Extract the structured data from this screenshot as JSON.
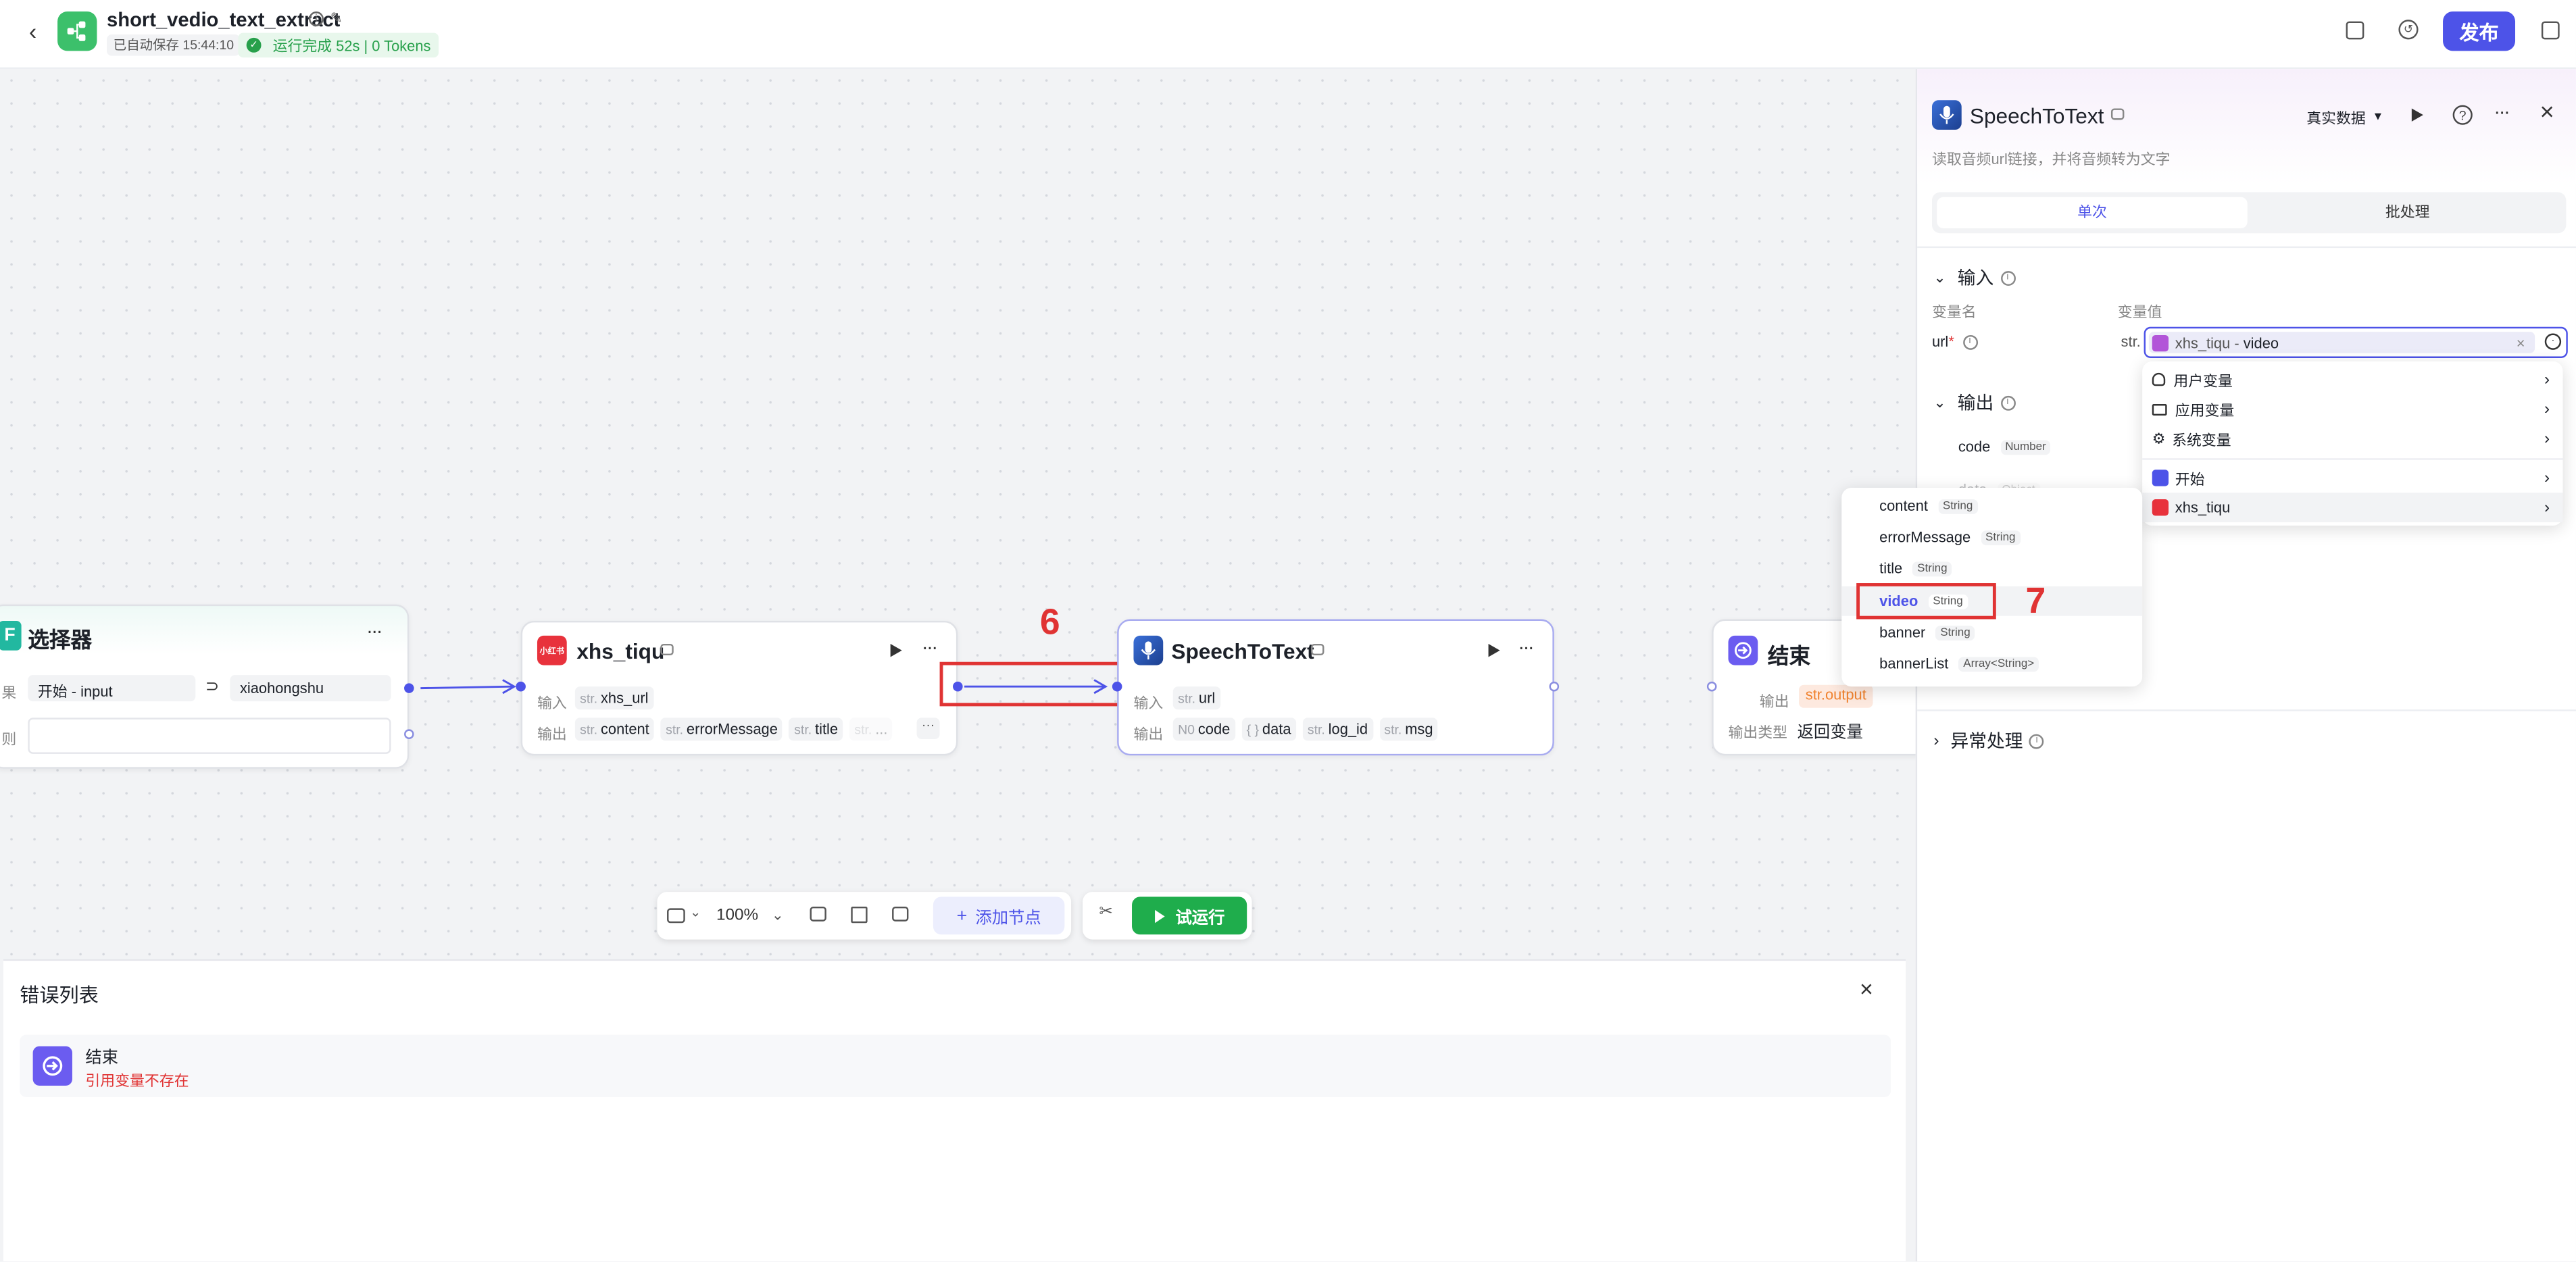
{
  "header": {
    "app_title": "short_vedio_text_extract",
    "autosave": "已自动保存 15:44:10",
    "run_status": "运行完成 52s | 0 Tokens",
    "publish_label": "发布",
    "accent_color": "#4d53e8"
  },
  "nodes": {
    "selector": {
      "title": "选择器",
      "row1_label": "果",
      "cond_left": "开始 - input",
      "cond_op": "⊃",
      "cond_right": "xiaohongshu",
      "row2_label": "则",
      "icon": "F"
    },
    "xhs": {
      "title": "xhs_tiqu",
      "icon_text": "小红书",
      "input_label": "输入",
      "input_tags": [
        {
          "type": "str.",
          "name": "xhs_url"
        }
      ],
      "output_label": "输出",
      "output_tags": [
        {
          "type": "str.",
          "name": "content"
        },
        {
          "type": "str.",
          "name": "errorMessage"
        },
        {
          "type": "str.",
          "name": "title"
        },
        {
          "type": "str.",
          "name": "..."
        }
      ],
      "more": "···"
    },
    "speech": {
      "title": "SpeechToText",
      "input_label": "输入",
      "input_tags": [
        {
          "type": "str.",
          "name": "url"
        }
      ],
      "output_label": "输出",
      "output_tags": [
        {
          "type": "N0",
          "name": "code"
        },
        {
          "type": "{ }",
          "name": "data"
        },
        {
          "type": "str.",
          "name": "log_id"
        },
        {
          "type": "str.",
          "name": "msg"
        }
      ]
    },
    "end": {
      "title": "结束",
      "output_label": "输出",
      "output_value": "str.output",
      "output_type_label": "输出类型",
      "output_type_value": "返回变量"
    }
  },
  "annotations": {
    "step6": "6",
    "step7": "7"
  },
  "toolbar": {
    "zoom": "100%",
    "add_node": "添加节点",
    "test_run": "试运行"
  },
  "error_list": {
    "title": "错误列表",
    "items": [
      {
        "title": "结束",
        "message": "引用变量不存在"
      }
    ]
  },
  "panel": {
    "title": "SpeechToText",
    "description": "读取音频url链接，并将音频转为文字",
    "data_mode": "真实数据",
    "tabs": [
      "单次",
      "批处理"
    ],
    "input_section": "输入",
    "col_var_name": "变量名",
    "col_var_value": "变量值",
    "param_name": "url",
    "param_required": "*",
    "param_type": "str.",
    "param_value_node": "xhs_tiqu",
    "param_value_sep": " - ",
    "param_value_field": "video",
    "output_section": "输出",
    "output_rows": [
      {
        "name": "code",
        "type": "Number"
      },
      {
        "name": "data",
        "type": "Object"
      }
    ],
    "exception_section": "异常处理"
  },
  "var_menu": {
    "items": [
      "用户变量",
      "应用变量",
      "系统变量",
      "开始",
      "xhs_tiqu"
    ]
  },
  "sub_menu": {
    "items": [
      {
        "name": "content",
        "type": "String"
      },
      {
        "name": "errorMessage",
        "type": "String"
      },
      {
        "name": "title",
        "type": "String"
      },
      {
        "name": "video",
        "type": "String"
      },
      {
        "name": "banner",
        "type": "String"
      },
      {
        "name": "bannerList",
        "type": "Array<String>"
      }
    ],
    "selected": "video"
  }
}
